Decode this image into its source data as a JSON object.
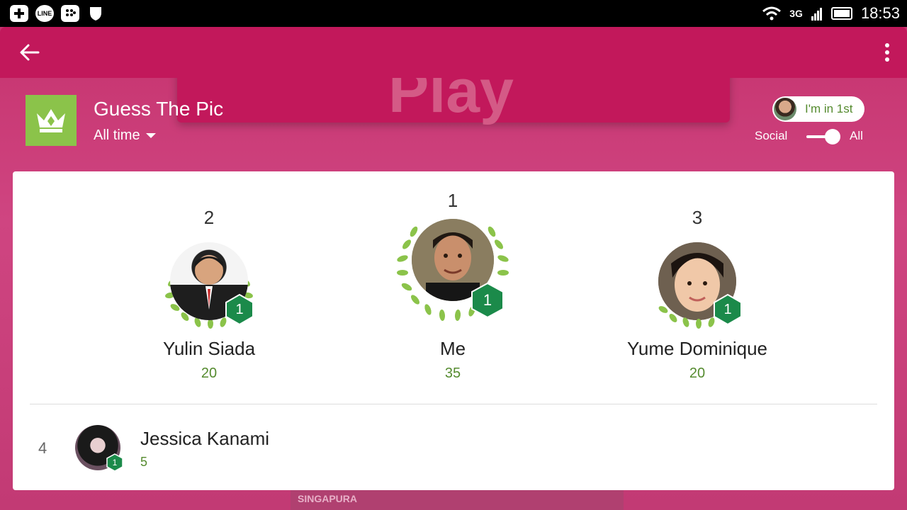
{
  "status_bar": {
    "notification_icons": [
      "plus-icon",
      "line-icon",
      "bbm-icon",
      "shield-icon"
    ],
    "line_label": "LINE",
    "network": "3G",
    "time": "18:53"
  },
  "background": {
    "play_text": "Play",
    "bottom_text": "SINGAPURA"
  },
  "header": {
    "game_title": "Guess The Pic",
    "time_filter": "All time",
    "rank_chip": "I'm in 1st",
    "toggle_left_label": "Social",
    "toggle_right_label": "All",
    "toggle_on": true
  },
  "podium": [
    {
      "rank": "2",
      "name": "Yulin Siada",
      "score": "20",
      "level": "1"
    },
    {
      "rank": "1",
      "name": "Me",
      "score": "35",
      "level": "1"
    },
    {
      "rank": "3",
      "name": "Yume Dominique",
      "score": "20",
      "level": "1"
    }
  ],
  "list": [
    {
      "rank": "4",
      "name": "Jessica Kanami",
      "score": "5",
      "level": "1"
    }
  ],
  "colors": {
    "primary": "#c2185b",
    "accent_green": "#8bc34a",
    "score_green": "#558b2f",
    "badge_green": "#1b8a4a"
  }
}
